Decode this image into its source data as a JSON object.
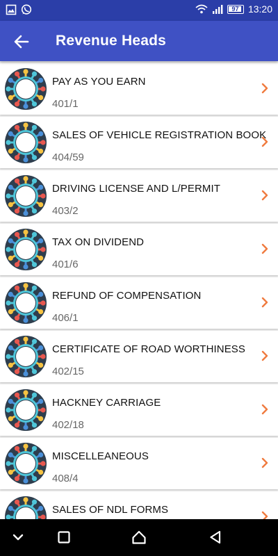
{
  "status_bar": {
    "time": "13:20",
    "battery": "97",
    "icons": [
      "gallery-icon",
      "whatsapp-icon",
      "wifi-icon",
      "signal-icon",
      "battery-icon"
    ]
  },
  "app_bar": {
    "title": "Revenue Heads",
    "back_icon": "arrow-left-icon"
  },
  "revenue_heads": [
    {
      "name": "PAY AS YOU EARN",
      "code": "401/1"
    },
    {
      "name": "SALES OF VEHICLE REGISTRATION BOOK",
      "code": "404/59"
    },
    {
      "name": "DRIVING LICENSE AND L/PERMIT",
      "code": "403/2"
    },
    {
      "name": "TAX ON DIVIDEND",
      "code": "401/6"
    },
    {
      "name": "REFUND OF COMPENSATION",
      "code": "406/1"
    },
    {
      "name": "CERTIFICATE OF ROAD WORTHINESS",
      "code": "402/15"
    },
    {
      "name": "HACKNEY CARRIAGE",
      "code": "402/18"
    },
    {
      "name": "MISCELLEANEOUS",
      "code": "408/4"
    },
    {
      "name": "SALES OF NDL FORMS",
      "code": ""
    }
  ],
  "colors": {
    "app_bar": "#3f51c4",
    "status_bar": "#2b3ea8",
    "chevron": "#f07b3f",
    "logo_bg": "#2e3e4e",
    "logo_yellow": "#f6c342",
    "logo_red": "#e8584f",
    "logo_cyan": "#4fc6d9",
    "logo_blue": "#4a90d9"
  },
  "nav_bar": {
    "icons": [
      "collapse-icon",
      "recents-icon",
      "home-icon",
      "back-icon"
    ]
  }
}
